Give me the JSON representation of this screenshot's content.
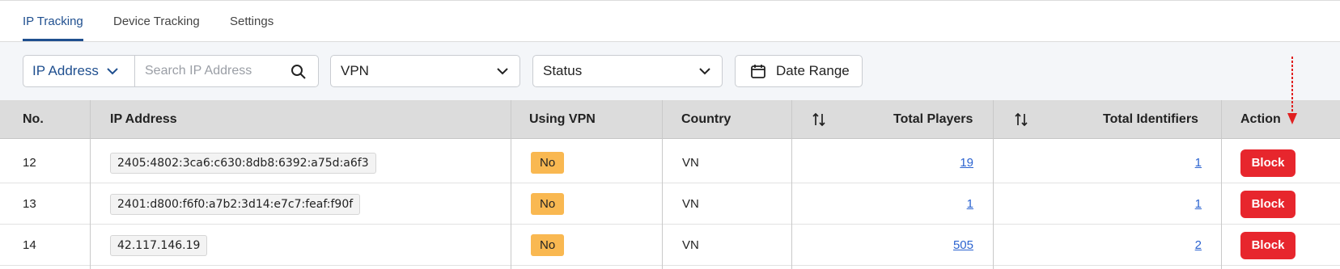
{
  "tabs": [
    {
      "label": "IP Tracking",
      "active": true
    },
    {
      "label": "Device Tracking",
      "active": false
    },
    {
      "label": "Settings",
      "active": false
    }
  ],
  "filters": {
    "ip_select": "IP Address",
    "search_placeholder": "Search IP Address",
    "vpn": "VPN",
    "status": "Status",
    "date_range": "Date Range"
  },
  "table": {
    "headers": {
      "no": "No.",
      "ip": "IP Address",
      "vpn": "Using VPN",
      "country": "Country",
      "players": "Total Players",
      "identifiers": "Total Identifiers",
      "action": "Action"
    },
    "rows": [
      {
        "no": "12",
        "ip": "2405:4802:3ca6:c630:8db8:6392:a75d:a6f3",
        "vpn": "No",
        "country": "VN",
        "players": "19",
        "identifiers": "1",
        "action": "Block"
      },
      {
        "no": "13",
        "ip": "2401:d800:f6f0:a7b2:3d14:e7c7:feaf:f90f",
        "vpn": "No",
        "country": "VN",
        "players": "1",
        "identifiers": "1",
        "action": "Block"
      },
      {
        "no": "14",
        "ip": "42.117.146.19",
        "vpn": "No",
        "country": "VN",
        "players": "505",
        "identifiers": "2",
        "action": "Block"
      }
    ]
  },
  "colors": {
    "accent": "#1f4f8f",
    "header_bg": "#dcdcdc",
    "vpn_badge": "#f9b851",
    "block_button": "#e7262d",
    "link": "#2b63d0",
    "annotation_arrow": "#e02020"
  },
  "icons": {
    "dropdown": "chevron-down-icon",
    "search": "search-icon",
    "calendar": "calendar-icon",
    "sort": "sort-icon",
    "annotation": "arrow-down-annotation"
  }
}
